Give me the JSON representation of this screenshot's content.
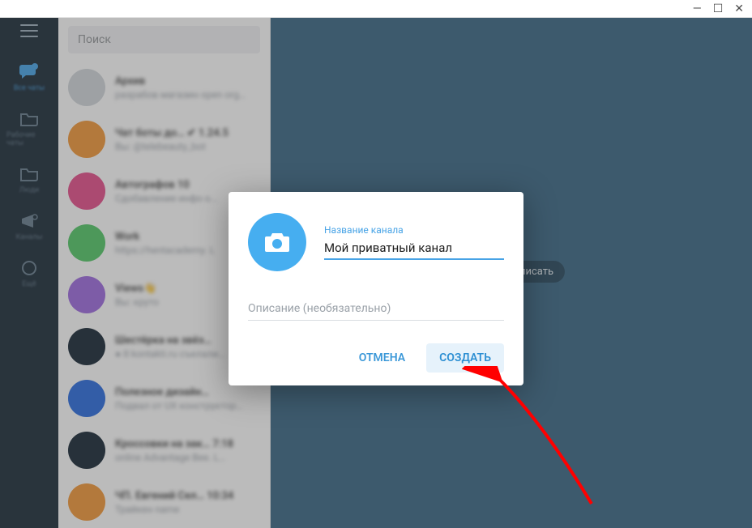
{
  "window_controls": {
    "minimize": "—",
    "maximize": "☐",
    "close": "✕"
  },
  "search": {
    "placeholder": "Поиск"
  },
  "rail": {
    "items": [
      {
        "label": "Все чаты"
      },
      {
        "label": "Рабочие чаты"
      },
      {
        "label": "Люди"
      },
      {
        "label": "Каналы"
      },
      {
        "label": "Ещё"
      }
    ]
  },
  "chats": [
    {
      "color": "#d3d7dc",
      "title": "Архив",
      "sub": "разрабов магазин open org…"
    },
    {
      "color": "#f39a3d",
      "title": "Чат боты до…  ✔ 1.24.5",
      "sub": "Вы: @telebeauty_bot"
    },
    {
      "color": "#e6528e",
      "title": "Автографов 10",
      "sub": "Сдобавление инфо о..."
    },
    {
      "color": "#57c96b",
      "title": "Work",
      "sub": "https://hentacademy. L"
    },
    {
      "color": "#a06de0",
      "title": "Views👋",
      "sub": "Вы: круто"
    },
    {
      "color": "#1c2b3a",
      "title": "Шестёрка на звёз…",
      "sub": "● 8 kontakti.ru съелали…"
    },
    {
      "color": "#2f6fe0",
      "title": "Полезное дизайн…",
      "sub": "Подвал от UX конструктор…"
    },
    {
      "color": "#1c2b3a",
      "title": "Кроссовки на зак… 7:18",
      "sub": "online Advantage Bee. L…"
    },
    {
      "color": "#f39a3d",
      "title": "ЧП. Евгений Сел… 10:34",
      "sub": "Трайкен name"
    }
  ],
  "main": {
    "hint": "…ли бы написать"
  },
  "modal": {
    "name_field_label": "Название канала",
    "name_value": "Мой приватный канал",
    "desc_placeholder": "Описание (необязательно)",
    "cancel": "ОТМЕНА",
    "create": "СОЗДАТЬ"
  },
  "icons": {
    "camera": "camera-icon",
    "chats": "chats-icon",
    "folder": "folder-icon",
    "people": "people-icon",
    "channel": "channel-icon",
    "more": "more-icon"
  },
  "colors": {
    "accent": "#47a3e6",
    "primary_btn_bg": "#e6f2fb",
    "main_bg": "#3e6a87"
  },
  "annotation": {
    "arrow_color": "#ff0000"
  }
}
